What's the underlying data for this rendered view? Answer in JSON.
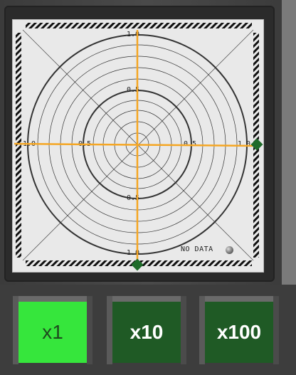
{
  "scope": {
    "axis_labels": {
      "top_outer": "1.0",
      "top_inner": "0.5",
      "left_outer": "1.0",
      "left_inner": "0.5",
      "right_inner": "0.5",
      "right_outer": "1.0",
      "bottom_inner": "0.5",
      "bottom_outer": "1.0"
    },
    "status_text": "NO DATA",
    "colors": {
      "crosshair": "#f5a623",
      "marker": "#1f6b2a",
      "ring": "#222222",
      "screen_bg": "#e9e9e9"
    },
    "markers": [
      "right-edge-marker",
      "bottom-edge-marker"
    ]
  },
  "buttons": [
    {
      "label": "x1",
      "state": "active"
    },
    {
      "label": "x10",
      "state": "inactive"
    },
    {
      "label": "x100",
      "state": "inactive"
    }
  ]
}
